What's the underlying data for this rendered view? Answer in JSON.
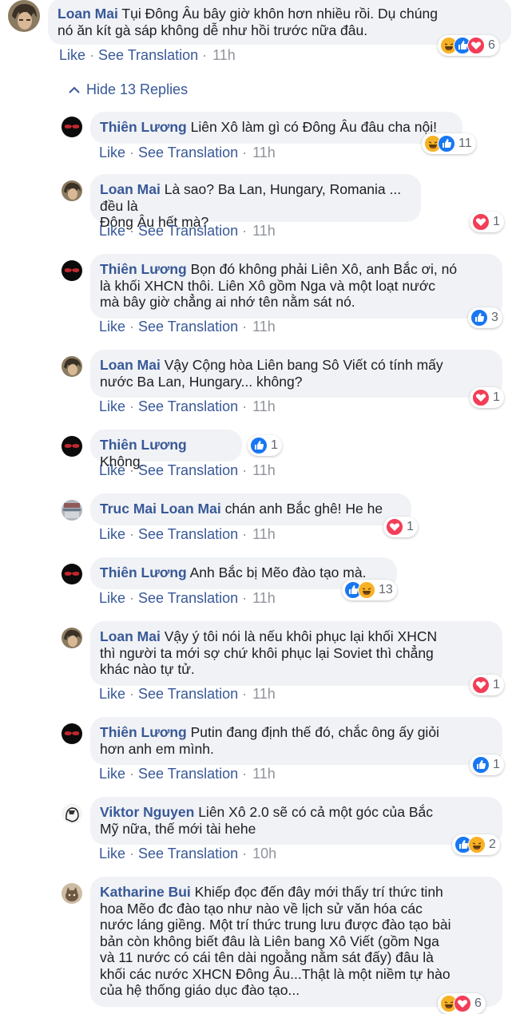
{
  "top": {
    "name": "Loan Mai",
    "lines": [
      "Tụi Đông Âu bây giờ khôn hơn nhiều rồi. Dụ chúng",
      "nó ăn kít gà sáp không dễ như hồi trước nữa đâu."
    ],
    "like": "Like",
    "translate": "See Translation",
    "time": "11h",
    "reactions": [
      "haha",
      "like",
      "love"
    ],
    "count": "6"
  },
  "hide_replies": "Hide 13 Replies",
  "replies": [
    {
      "name": "Thiên Lương",
      "lines": [
        "Liên Xô làm gì có Đông Âu đâu cha nội!"
      ],
      "like": "Like",
      "translate": "See Translation",
      "time": "11h",
      "reactions": [
        "haha",
        "like"
      ],
      "count": "11"
    },
    {
      "name": "Loan Mai",
      "lines": [
        "Là sao? Ba Lan, Hungary, Romania ... đều là",
        "Đông Âu hết mà?"
      ],
      "like": "Like",
      "translate": "See Translation",
      "time": "11h",
      "reactions": [
        "love"
      ],
      "count": "1"
    },
    {
      "name": "Thiên Lương",
      "lines": [
        "Bọn đó không phải Liên Xô, anh Bắc ơi, nó",
        "là khối XHCN thôi. Liên Xô gồm Nga và một loạt nước",
        "mà bây giờ chẳng ai nhớ tên nằm sát nó."
      ],
      "like": "Like",
      "translate": "See Translation",
      "time": "11h",
      "reactions": [
        "like"
      ],
      "count": "3"
    },
    {
      "name": "Loan Mai",
      "lines": [
        "Vậy Cộng hòa Liên bang Sô Viết có tính mấy",
        "nước Ba Lan, Hungary... không?"
      ],
      "like": "Like",
      "translate": "See Translation",
      "time": "11h",
      "reactions": [
        "love"
      ],
      "count": "1"
    },
    {
      "name": "Thiên Lương",
      "lines": [
        "Không."
      ],
      "like": "Like",
      "translate": "See Translation",
      "time": "11h",
      "reactions": [
        "like"
      ],
      "count": "1"
    },
    {
      "name": "Truc Mai",
      "mention": "Loan Mai",
      "lines": [
        "chán anh Bắc ghê! He he"
      ],
      "like": "Like",
      "translate": "See Translation",
      "time": "11h",
      "reactions": [
        "love"
      ],
      "count": "1"
    },
    {
      "name": "Thiên Lương",
      "lines": [
        "Anh Bắc bị Mẽo đào tạo mà."
      ],
      "like": "Like",
      "translate": "See Translation",
      "time": "11h",
      "reactions": [
        "like",
        "haha"
      ],
      "count": "13"
    },
    {
      "name": "Loan Mai",
      "lines": [
        "Vậy ý tôi nói là nếu khôi phục lại khối XHCN",
        "thì người ta mới sợ chứ khôi phục lại Soviet thì chẳng",
        "khác nào tự tử."
      ],
      "like": "Like",
      "translate": "See Translation",
      "time": "11h",
      "reactions": [
        "love"
      ],
      "count": "1"
    },
    {
      "name": "Thiên Lương",
      "lines": [
        "Putin đang định thế đó, chắc ông ấy giỏi",
        "hơn anh em mình."
      ],
      "like": "Like",
      "translate": "See Translation",
      "time": "11h",
      "reactions": [
        "like"
      ],
      "count": "1"
    },
    {
      "name": "Viktor Nguyen",
      "lines": [
        "Liên Xô 2.0 sẽ có cả một góc của Bắc",
        "Mỹ nữa, thế mới tài hehe"
      ],
      "like": "Like",
      "translate": "See Translation",
      "time": "10h",
      "reactions": [
        "like",
        "haha"
      ],
      "count": "2"
    },
    {
      "name": "Katharine Bui",
      "lines": [
        "Khiếp đọc đến đây mới thấy trí thức tinh",
        "hoa Mẽo đc đào tạo như nào về lịch sử văn hóa các",
        "nước láng giềng. Một trí thức trung lưu được đào tạo bài",
        "bản còn không biết đâu là Liên bang Xô Viết (gồm Nga",
        "và 11 nước có cái tên dài ngoằng nằm sát đấy) đâu là",
        "khối các nước XHCN Đông Âu...Thật là một niềm tự hào",
        "của hệ thống giáo dục đào tạo..."
      ],
      "reactions": [
        "haha",
        "love"
      ],
      "count": "6"
    }
  ]
}
